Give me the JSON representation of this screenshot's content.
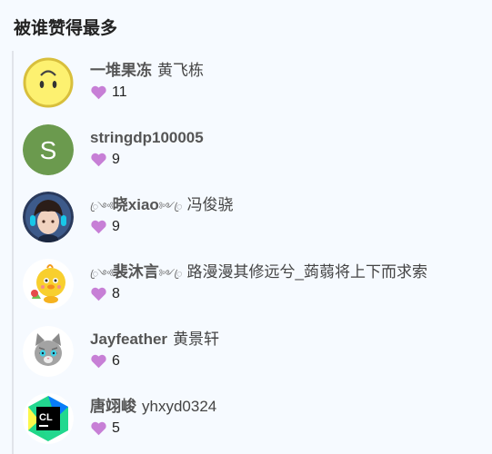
{
  "section": {
    "title": "被谁赞得最多"
  },
  "icons": {
    "heart": "heart-icon"
  },
  "colors": {
    "heart": "#c77fd6",
    "background": "#f6faff",
    "rule": "#e1e4ea"
  },
  "users": [
    {
      "username": "一堆果冻",
      "full_name": "黄飞栋",
      "likes": "11",
      "avatar": "smiley-face"
    },
    {
      "username": "stringdp100005",
      "full_name": "",
      "likes": "9",
      "avatar": "letter",
      "avatar_letter": "S",
      "avatar_color": "#6b9a4e"
    },
    {
      "username_prefix": "ꦿ༺",
      "username": "晓xiao",
      "username_suffix": "༻ꦿ",
      "full_name": "冯俊骁",
      "likes": "9",
      "avatar": "anime-boy-headphones"
    },
    {
      "username_prefix": "ꦿ༺",
      "username": "裴沐言",
      "username_suffix": "༻ꦿ",
      "full_name": "路漫漫其修远兮_蒟蒻将上下而求索",
      "likes": "8",
      "avatar": "chick-cartoon"
    },
    {
      "username": "Jayfeather",
      "full_name": "黄景轩",
      "likes": "6",
      "avatar": "grey-cat"
    },
    {
      "username": "唐翊峻",
      "full_name": "yhxyd0324",
      "likes": "5",
      "avatar": "clion-logo",
      "avatar_letter": "CL"
    }
  ]
}
